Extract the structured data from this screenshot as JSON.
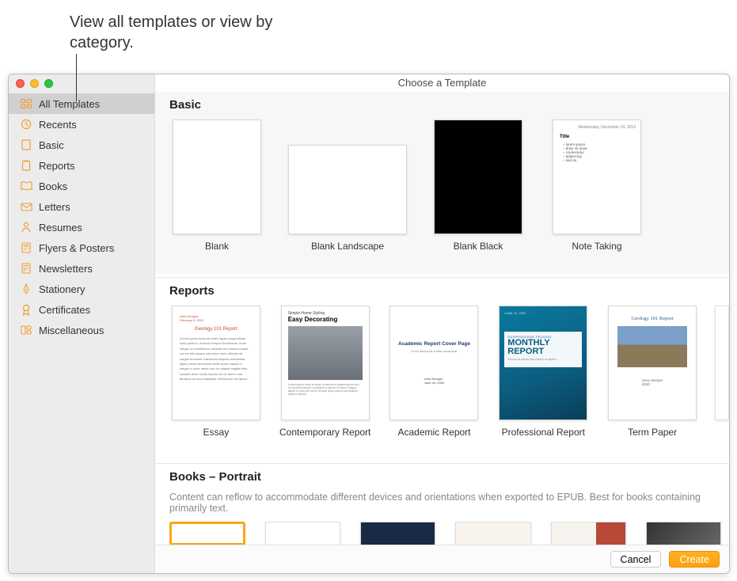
{
  "callout": "View all templates or view by category.",
  "window_title": "Choose a Template",
  "sidebar": {
    "items": [
      {
        "label": "All Templates",
        "icon": "grid",
        "selected": true
      },
      {
        "label": "Recents",
        "icon": "clock"
      },
      {
        "label": "Basic",
        "icon": "doc"
      },
      {
        "label": "Reports",
        "icon": "clipboard"
      },
      {
        "label": "Books",
        "icon": "book"
      },
      {
        "label": "Letters",
        "icon": "letter"
      },
      {
        "label": "Resumes",
        "icon": "person"
      },
      {
        "label": "Flyers & Posters",
        "icon": "flyer"
      },
      {
        "label": "Newsletters",
        "icon": "news"
      },
      {
        "label": "Stationery",
        "icon": "pen"
      },
      {
        "label": "Certificates",
        "icon": "ribbon"
      },
      {
        "label": "Miscellaneous",
        "icon": "misc"
      }
    ]
  },
  "sections": {
    "basic": {
      "title": "Basic",
      "templates": [
        {
          "label": "Blank"
        },
        {
          "label": "Blank Landscape"
        },
        {
          "label": "Blank Black"
        },
        {
          "label": "Note Taking"
        }
      ]
    },
    "reports": {
      "title": "Reports",
      "templates": [
        {
          "label": "Essay"
        },
        {
          "label": "Contemporary Report"
        },
        {
          "label": "Academic Report"
        },
        {
          "label": "Professional Report"
        },
        {
          "label": "Term Paper"
        }
      ]
    },
    "books": {
      "title": "Books – Portrait",
      "description": "Content can reflow to accommodate different devices and orientations when exported to EPUB. Best for books containing primarily text."
    }
  },
  "thumbnail_text": {
    "essay_title": "Geology 101 Report",
    "contemp_kicker": "Simple Home Styling",
    "contemp_title": "Easy Decorating",
    "acad_title": "Academic Report Cover Page",
    "prof_kicker": "SUSPENDISSE FEUGIAT",
    "prof_title": "MONTHLY REPORT",
    "term_title": "Geology 101 Report"
  },
  "footer": {
    "cancel": "Cancel",
    "create": "Create"
  },
  "colors": {
    "accent": "#ff9f0a",
    "selection": "#f7a817"
  }
}
